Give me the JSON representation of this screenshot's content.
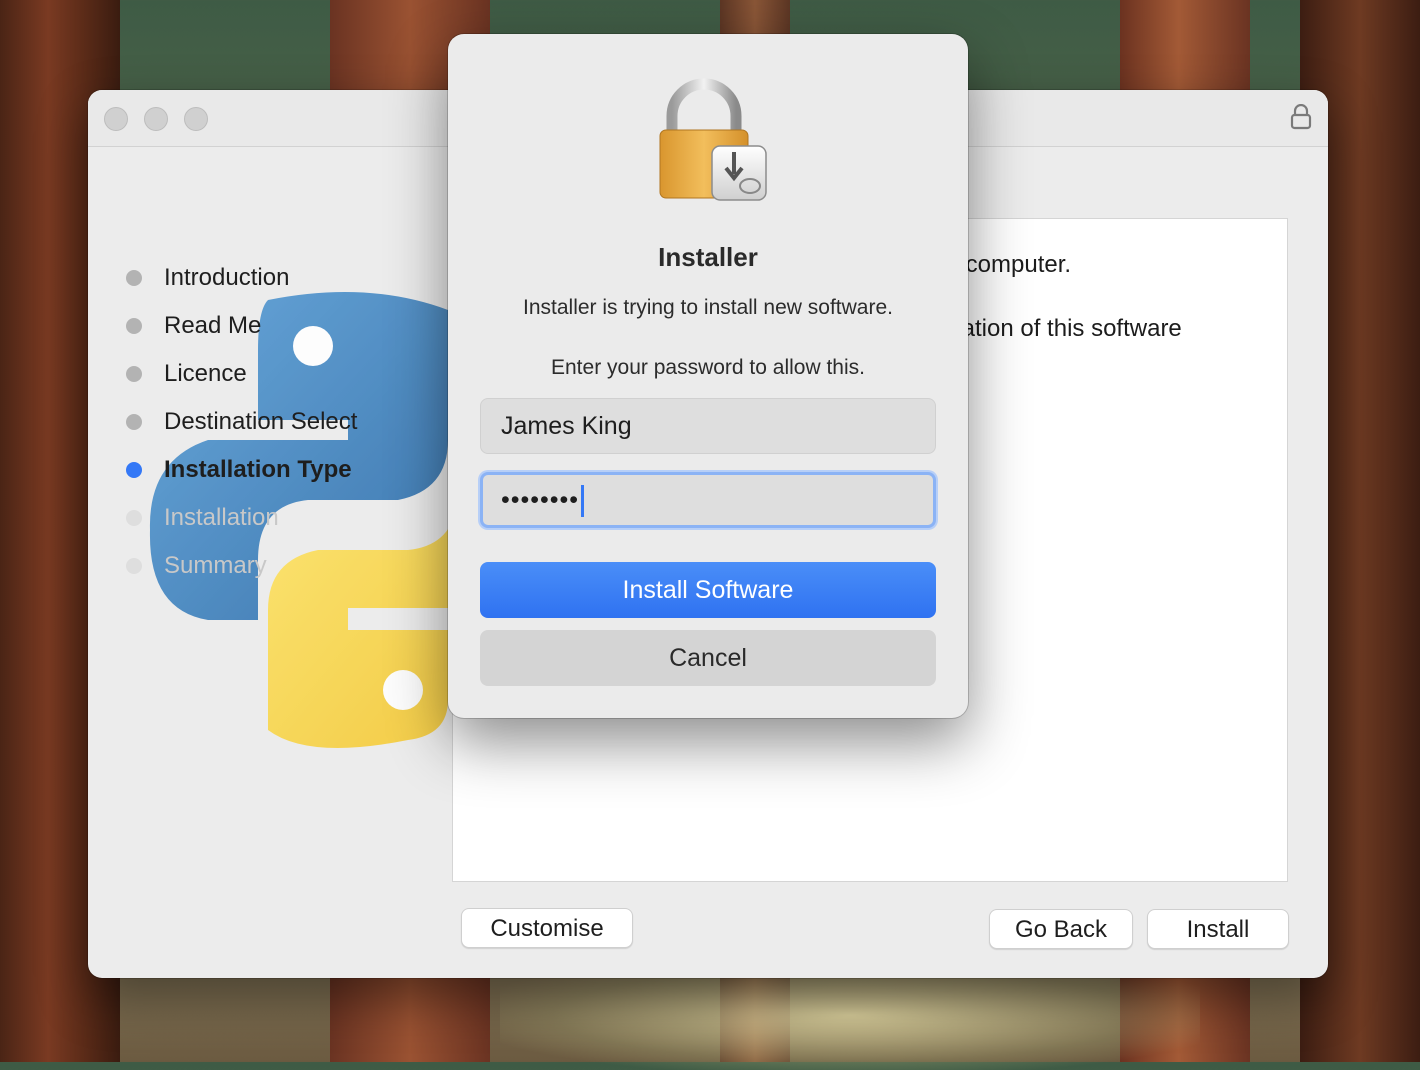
{
  "window": {
    "steps": [
      {
        "label": "Introduction",
        "state": "done"
      },
      {
        "label": "Read Me",
        "state": "done"
      },
      {
        "label": "Licence",
        "state": "done"
      },
      {
        "label": "Destination Select",
        "state": "done"
      },
      {
        "label": "Installation Type",
        "state": "active"
      },
      {
        "label": "Installation",
        "state": "pending"
      },
      {
        "label": "Summary",
        "state": "pending"
      }
    ],
    "content": {
      "line1": "r computer.",
      "line2": "llation of this software"
    },
    "buttons": {
      "customise": "Customise",
      "go_back": "Go Back",
      "install": "Install"
    }
  },
  "dialog": {
    "title": "Installer",
    "message": "Installer is trying to install new software.",
    "prompt": "Enter your password to allow this.",
    "username": "James King",
    "password_mask": "••••••••",
    "install_button": "Install Software",
    "cancel_button": "Cancel"
  },
  "colors": {
    "accent": "#3478f6",
    "window_bg": "#ececec",
    "dialog_bg": "#ebebeb"
  },
  "icons": [
    "lock-icon",
    "python-logo",
    "installer-lock-icon"
  ]
}
